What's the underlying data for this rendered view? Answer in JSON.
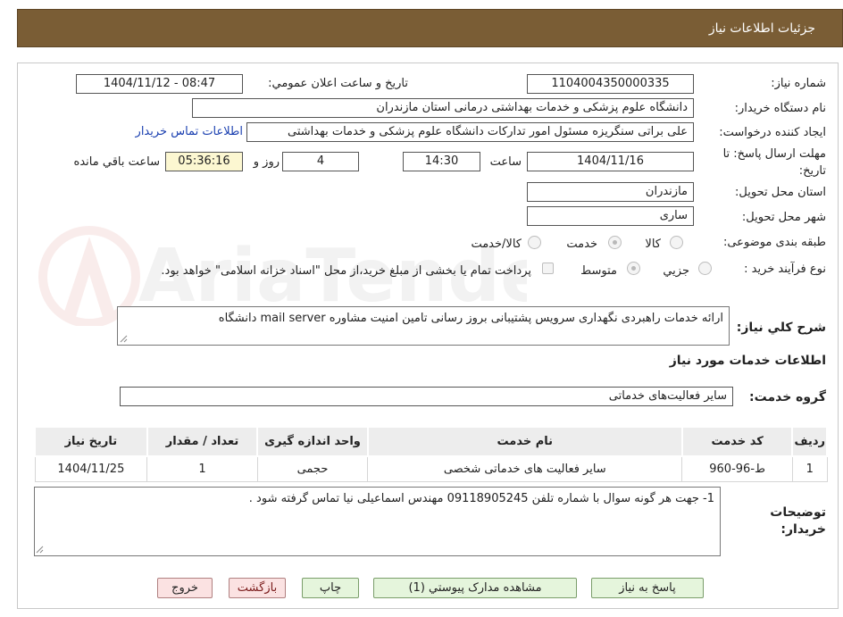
{
  "header": {
    "title": "جزئیات اطلاعات نیاز"
  },
  "form": {
    "need_number": {
      "label": "شماره نیاز:",
      "value": "1104004350000335"
    },
    "announce_datetime": {
      "label": "تاریخ و ساعت اعلان عمومي:",
      "value": "1404/11/12 - 08:47"
    },
    "buyer_org": {
      "label": "نام دستگاه خريدار:",
      "value": "دانشگاه علوم پزشکی و خدمات بهداشتی  درمانی استان مازندران"
    },
    "requester": {
      "label": "ایجاد کننده درخواست:",
      "value": "علی براتی سنگریزه مسئول امور تدارکات دانشگاه علوم پزشکی و خدمات بهداشتی",
      "contact_link": "اطلاعات تماس خریدار"
    },
    "deadline": {
      "label_line1": "مهلت ارسال پاسخ: تا",
      "label_line2": "تاریخ:",
      "date": "1404/11/16",
      "time_label": "ساعت",
      "time": "14:30",
      "days": "4",
      "days_label": "روز و",
      "remaining": "05:36:16",
      "remaining_label": "ساعت باقي مانده"
    },
    "province": {
      "label": "استان محل تحویل:",
      "value": "مازندران"
    },
    "city": {
      "label": "شهر محل تحویل:",
      "value": "ساری"
    },
    "category": {
      "label": "طبقه بندی موضوعی:",
      "options": [
        "کالا",
        "خدمت",
        "کالا/خدمت"
      ],
      "selected": "خدمت"
    },
    "process": {
      "label": "نوع فرآیند خرید :",
      "options": [
        "جزيي",
        "متوسط"
      ],
      "selected": "متوسط",
      "note": "پرداخت تمام یا بخشی از مبلغ خرید،از محل \"اسناد خزانه اسلامی\" خواهد بود."
    },
    "summary": {
      "label": "شرح کلي نياز:",
      "value": "ارائه خدمات راهبردی نگهداری سرویس پشتیبانی بروز رسانی تامین امنیت مشاوره mail server دانشگاه"
    }
  },
  "services_section": {
    "title": "اطلاعات خدمات مورد نياز",
    "group_label": "گروه خدمت:",
    "group_value": "سایر فعالیت‌های خدماتی"
  },
  "table": {
    "headers": [
      "رديف",
      "کد خدمت",
      "نام خدمت",
      "واحد اندازه گیری",
      "تعداد / مقدار",
      "تاریخ نیاز"
    ],
    "rows": [
      [
        "1",
        "ط-96-960",
        "سایر فعالیت های خدماتی شخصی",
        "حجمی",
        "1",
        "1404/11/25"
      ]
    ]
  },
  "buyer_notes": {
    "label_line1": "توضیحات",
    "label_line2": "خریدار:",
    "value": "1- جهت هر گونه سوال با شماره تلفن 09118905245 مهندس اسماعیلی نیا تماس گرفته شود ."
  },
  "buttons": {
    "reply": "پاسخ به نياز",
    "attachments": "مشاهده مدارک پیوستي (1)",
    "print": "چاپ",
    "back": "بازگشت",
    "exit": "خروج"
  },
  "watermark": {
    "text": "AriaTender.neT"
  },
  "colors": {
    "header_bg": "#7a5d35",
    "link": "#1a3fb0",
    "remaining_bg": "#fcf7d1",
    "green_button": "#e5f5dc",
    "pink_button": "#fbe2e2"
  }
}
